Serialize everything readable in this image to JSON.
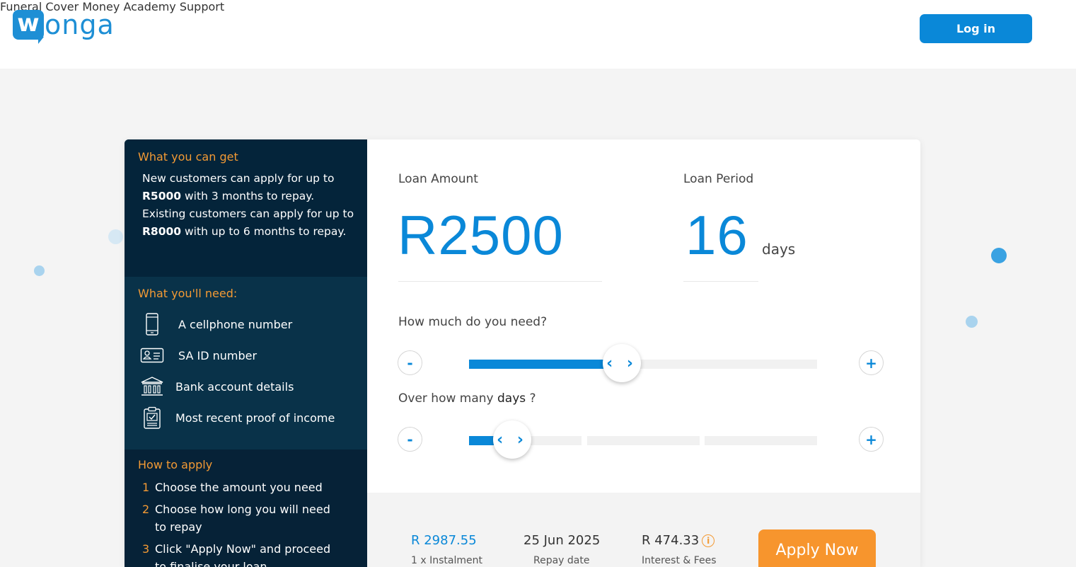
{
  "brand": {
    "logo_letter": "w",
    "logo_rest": "onga",
    "primary_color": "#0a88d8",
    "accent_color": "#f7952d"
  },
  "nav": {
    "items": [
      "Funeral Cover",
      "Money Academy",
      "Support"
    ],
    "login_label": "Log in"
  },
  "sidebar": {
    "get_title": "What you can get",
    "get_text_1": "New customers can apply for up to ",
    "get_bold_1": "R5000",
    "get_text_2": " with 3 months to repay. Existing customers can apply for up to ",
    "get_bold_2": "R8000",
    "get_text_3": " with up to 6 months to repay.",
    "need_title": "What you'll need:",
    "needs": [
      {
        "icon": "cellphone-icon",
        "label": "A cellphone number"
      },
      {
        "icon": "id-card-icon",
        "label": "SA ID number"
      },
      {
        "icon": "bank-icon",
        "label": "Bank account details"
      },
      {
        "icon": "clipboard-icon",
        "label": "Most recent proof of income"
      }
    ],
    "apply_title": "How to apply",
    "steps": [
      {
        "num": "1",
        "text": "Choose the amount you need"
      },
      {
        "num": "2",
        "text": "Choose how long you will need to repay"
      },
      {
        "num": "3",
        "text": "Click \"Apply Now\" and proceed to finalise your loan"
      }
    ]
  },
  "calculator": {
    "amount_label": "Loan Amount",
    "amount_value": "R2500",
    "period_label": "Loan Period",
    "period_value": "16",
    "period_unit": "days",
    "amount_question": "How much do you need?",
    "days_question_prefix": "Over how many ",
    "days_question_bold": "days",
    "days_question_suffix": " ?",
    "minus": "-",
    "plus": "+",
    "thumb_glyph": "‹ ›",
    "amount_slider_fraction": 0.44,
    "days_slider_fraction": 0.1
  },
  "summary": {
    "instalment_value": "R 2987.55",
    "instalment_label": "1 x Instalment",
    "repay_date_value": "25 Jun 2025",
    "repay_date_label": "Repay date",
    "fees_value": "R 474.33",
    "fees_label": "Interest & Fees",
    "info_glyph": "i",
    "apply_label": "Apply Now"
  }
}
